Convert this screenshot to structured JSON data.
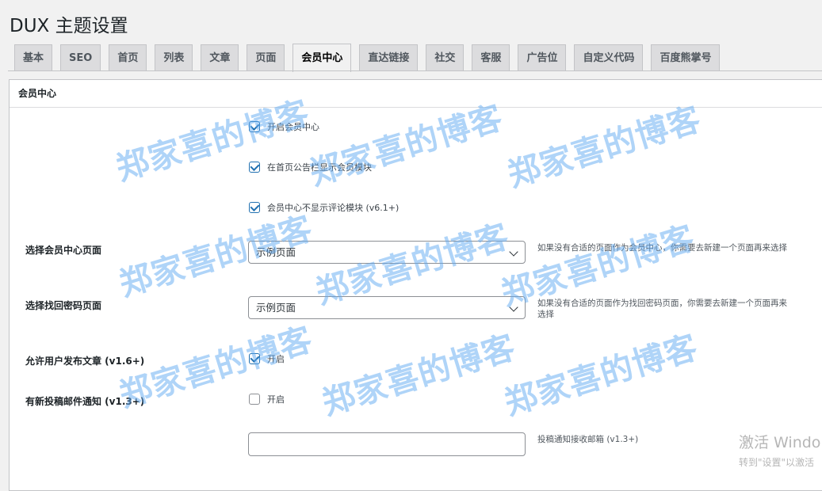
{
  "page_title": "DUX 主题设置",
  "tabs": [
    "基本",
    "SEO",
    "首页",
    "列表",
    "文章",
    "页面",
    "会员中心",
    "直达链接",
    "社交",
    "客服",
    "广告位",
    "自定义代码",
    "百度熊掌号"
  ],
  "active_tab": "会员中心",
  "section_title": "会员中心",
  "checkboxes": {
    "enable_member_center": {
      "label": "开启会员中心",
      "checked": true
    },
    "show_in_notice": {
      "label": "在首页公告栏显示会员模块",
      "checked": true
    },
    "hide_comments": {
      "label": "会员中心不显示评论模块 (v6.1+)",
      "checked": true
    }
  },
  "member_page": {
    "label": "选择会员中心页面",
    "value": "示例页面",
    "desc": "如果没有合适的页面作为会员中心，你需要去新建一个页面再来选择"
  },
  "password_page": {
    "label": "选择找回密码页面",
    "value": "示例页面",
    "desc": "如果没有合适的页面作为找回密码页面，你需要去新建一个页面再来选择"
  },
  "allow_publish": {
    "label": "允许用户发布文章 (v1.6+)",
    "checkbox_label": "开启",
    "checked": true
  },
  "email_notify": {
    "label": "有新投稿邮件通知 (v1.3+)",
    "checkbox_label": "开启",
    "checked": false
  },
  "notify_email": {
    "value": "",
    "desc": "投稿通知接收邮箱 (v1.3+)"
  },
  "watermark_text": "郑家喜的博客",
  "activate_windows": {
    "line1": "激活 Windo",
    "line2": "转到\"设置\"以激活"
  },
  "colors": {
    "accent": "#2271b1",
    "watermark": "#5faaf2"
  }
}
